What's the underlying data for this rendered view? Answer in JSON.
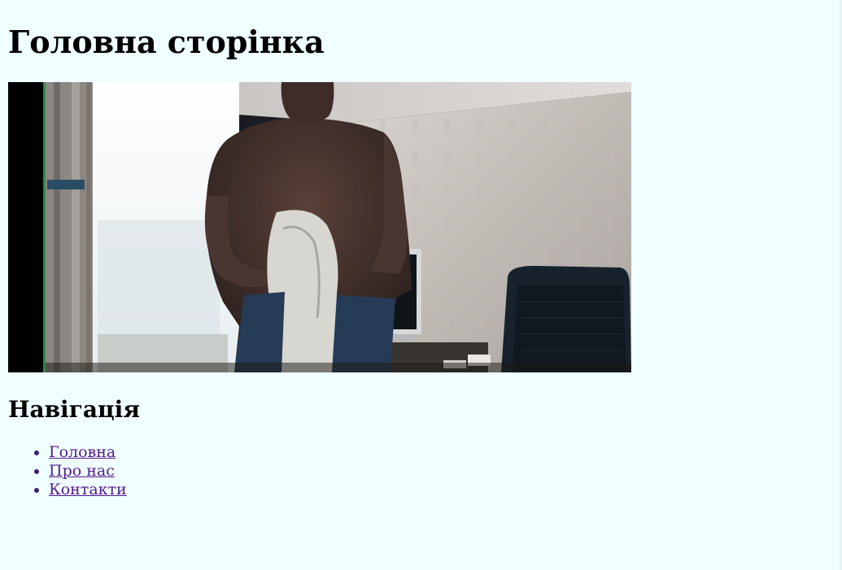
{
  "page": {
    "title": "Головна сторінка",
    "background": "#f0ffff"
  },
  "photo": {
    "alt": ""
  },
  "navigation": {
    "heading": "Навігація",
    "links": [
      {
        "label": "Головна"
      },
      {
        "label": "Про нас"
      },
      {
        "label": "Контакти"
      }
    ],
    "link_color": "#551a8b"
  }
}
